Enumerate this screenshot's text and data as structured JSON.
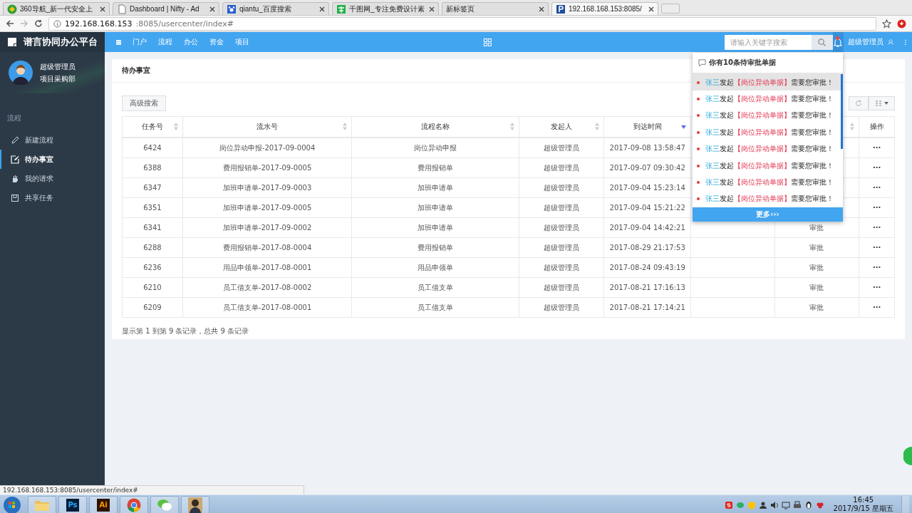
{
  "browser": {
    "tabs": [
      {
        "title": "360导航_新一代安全上",
        "selected": false
      },
      {
        "title": "Dashboard | Nifty - Ad",
        "selected": false
      },
      {
        "title": "qiantu_百度搜索",
        "selected": false
      },
      {
        "title": "千图网_专注免费设计素",
        "selected": false
      },
      {
        "title": "新标签页",
        "selected": false
      },
      {
        "title": "192.168.168.153:8085/",
        "selected": true
      }
    ],
    "address_host": "192.168.168.153",
    "address_path": ":8085/usercenter/index#",
    "status_url": "192.168.168.153:8085/usercenter/index#"
  },
  "app": {
    "brand": "谱言协同办公平台",
    "user": {
      "name": "超级管理员",
      "dept": "项目采购部"
    },
    "sidebar": {
      "section": "流程",
      "items": [
        {
          "label": "新建流程",
          "selected": false
        },
        {
          "label": "待办事宜",
          "selected": true
        },
        {
          "label": "我的请求",
          "selected": false
        },
        {
          "label": "共享任务",
          "selected": false
        }
      ]
    },
    "topnav": {
      "items": [
        "门户",
        "流程",
        "办公",
        "资金",
        "项目"
      ],
      "search": {
        "placeholder": "请输入关键字搜索"
      },
      "unread": true,
      "user_name": "超级管理员"
    },
    "card": {
      "title": "待办事宜",
      "advanced_search": "高级搜索",
      "table": {
        "columns": [
          {
            "label": "任务号",
            "sorted": false
          },
          {
            "label": "流水号",
            "sorted": false
          },
          {
            "label": "流程名称",
            "sorted": false
          },
          {
            "label": "发起人",
            "sorted": false
          },
          {
            "label": "到达时间",
            "sorted": true
          },
          {},
          {
            "sorted": false
          },
          {
            "label": "操作"
          }
        ],
        "rows": [
          {
            "task_id": "6424",
            "serial": "岗位异动申报-2017-09-0004",
            "process": "岗位异动申报",
            "initiator": "超级管理员",
            "arrival": "2017-09-08 13:58:47",
            "more": "···"
          },
          {
            "task_id": "6388",
            "serial": "费用报销单-2017-09-0005",
            "process": "费用报销单",
            "initiator": "超级管理员",
            "arrival": "2017-09-07 09:30:42",
            "more": "···"
          },
          {
            "task_id": "6347",
            "serial": "加班申请单-2017-09-0003",
            "process": "加班申请单",
            "initiator": "超级管理员",
            "arrival": "2017-09-04 15:23:14",
            "more": "···"
          },
          {
            "task_id": "6351",
            "serial": "加班申请单-2017-09-0005",
            "process": "加班申请单",
            "initiator": "超级管理员",
            "arrival": "2017-09-04 15:21:22",
            "more": "···"
          },
          {
            "task_id": "6341",
            "serial": "加班申请单-2017-09-0002",
            "process": "加班申请单",
            "initiator": "超级管理员",
            "arrival": "2017-09-04 14:42:21",
            "action": "审批",
            "more": "···"
          },
          {
            "task_id": "6288",
            "serial": "费用报销单-2017-08-0004",
            "process": "费用报销单",
            "initiator": "超级管理员",
            "arrival": "2017-08-29 21:17:53",
            "action": "审批",
            "more": "···"
          },
          {
            "task_id": "6236",
            "serial": "用品申领单-2017-08-0001",
            "process": "用品申领单",
            "initiator": "超级管理员",
            "arrival": "2017-08-24 09:43:19",
            "action": "审批",
            "more": "···"
          },
          {
            "task_id": "6210",
            "serial": "员工借支单-2017-08-0002",
            "process": "员工借支单",
            "initiator": "超级管理员",
            "arrival": "2017-08-21 17:16:13",
            "action": "审批",
            "more": "···"
          },
          {
            "task_id": "6209",
            "serial": "员工借支单-2017-08-0001",
            "process": "员工借支单",
            "initiator": "超级管理员",
            "arrival": "2017-08-21 17:14:21",
            "action": "审批",
            "more": "···"
          }
        ]
      },
      "pagination": "显示第 1 到第 9 条记录，总共 9 条记录"
    },
    "notifications": {
      "header": "你有10条待审批单据",
      "items": [
        {
          "sender": "张三",
          "verb": "发起",
          "doc": "【岗位异动单据】",
          "tail": "需要您审批！",
          "hovered": true
        },
        {
          "sender": "张三",
          "verb": "发起",
          "doc": "【岗位异动单据】",
          "tail": "需要您审批！",
          "hovered": false
        },
        {
          "sender": "张三",
          "verb": "发起",
          "doc": "【岗位异动单据】",
          "tail": "需要您审批！",
          "hovered": false
        },
        {
          "sender": "张三",
          "verb": "发起",
          "doc": "【岗位异动单据】",
          "tail": "需要您审批！",
          "hovered": false
        },
        {
          "sender": "张三",
          "verb": "发起",
          "doc": "【岗位异动单据】",
          "tail": "需要您审批！",
          "hovered": false
        },
        {
          "sender": "张三",
          "verb": "发起",
          "doc": "【岗位异动单据】",
          "tail": "需要您审批！",
          "hovered": false
        },
        {
          "sender": "张三",
          "verb": "发起",
          "doc": "【岗位异动单据】",
          "tail": "需要您审批！",
          "hovered": false
        },
        {
          "sender": "张三",
          "verb": "发起",
          "doc": "【岗位异动单据】",
          "tail": "需要您审批！",
          "hovered": false
        }
      ],
      "more": "更多›››"
    }
  },
  "taskbar": {
    "apps": [
      {
        "kind": "folder"
      },
      {
        "kind": "ps",
        "label": "Ps"
      },
      {
        "kind": "ai",
        "label": "Ai"
      },
      {
        "kind": "chrome"
      },
      {
        "kind": "wechat"
      },
      {
        "kind": "photo"
      }
    ],
    "time": "16:45",
    "date": "2017/9/15 星期五"
  }
}
